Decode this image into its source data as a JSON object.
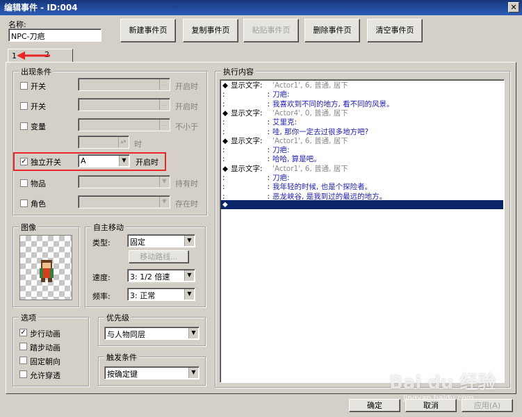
{
  "window": {
    "title": "编辑事件 - ID:004",
    "close_glyph": "✕"
  },
  "name_field": {
    "label": "名称:",
    "value": "NPC-刀疤"
  },
  "toolbar": {
    "new_page": "新建事件页",
    "copy_page": "复制事件页",
    "paste_page": "粘贴事件页",
    "delete_page": "删除事件页",
    "clear_page": "清空事件页"
  },
  "page_tabs": [
    {
      "label": "1"
    },
    {
      "label": "2"
    }
  ],
  "conditions": {
    "legend": "出现条件",
    "switch1": {
      "label": "开关",
      "suffix": "开启时",
      "checked": false
    },
    "switch2": {
      "label": "开关",
      "suffix": "开启时",
      "checked": false
    },
    "variable": {
      "label": "变量",
      "suffix": "不小于",
      "checked": false
    },
    "var_time": {
      "suffix": "时"
    },
    "self_switch": {
      "label": "独立开关",
      "value": "A",
      "suffix": "开启时",
      "checked": true
    },
    "item": {
      "label": "物品",
      "suffix": "持有时",
      "checked": false
    },
    "actor": {
      "label": "角色",
      "suffix": "存在时",
      "checked": false
    }
  },
  "image": {
    "legend": "图像"
  },
  "autonomous": {
    "legend": "自主移动",
    "type_label": "类型:",
    "type_value": "固定",
    "route_button": "移动路线...",
    "speed_label": "速度:",
    "speed_value": "3: 1/2 倍速",
    "freq_label": "频率:",
    "freq_value": "3: 正常"
  },
  "options": {
    "legend": "选项",
    "items": [
      {
        "label": "步行动画",
        "checked": true
      },
      {
        "label": "踏步动画",
        "checked": false
      },
      {
        "label": "固定朝向",
        "checked": false
      },
      {
        "label": "允许穿透",
        "checked": false
      }
    ]
  },
  "priority": {
    "legend": "优先级",
    "value": "与人物同层"
  },
  "trigger": {
    "legend": "触发条件",
    "value": "按确定键"
  },
  "commands": {
    "legend": "执行内容",
    "lines": [
      {
        "prefix": "◆",
        "head": "显示文字:",
        "text": "'Actor1', 6, 普通, 居下",
        "style": "gray"
      },
      {
        "prefix": ":",
        "head": ":",
        "text": "刀疤:",
        "style": "blue"
      },
      {
        "prefix": ":",
        "head": ":",
        "text": "我喜欢到不同的地方, 看不同的风景。",
        "style": "blue"
      },
      {
        "prefix": "◆",
        "head": "显示文字:",
        "text": "'Actor4', 0, 普通, 居下",
        "style": "gray"
      },
      {
        "prefix": ":",
        "head": ":",
        "text": "艾里克:",
        "style": "blue"
      },
      {
        "prefix": ":",
        "head": ":",
        "text": "哇, 那你一定去过很多地方吧?",
        "style": "blue"
      },
      {
        "prefix": "◆",
        "head": "显示文字:",
        "text": "'Actor1', 6, 普通, 居下",
        "style": "gray"
      },
      {
        "prefix": ":",
        "head": ":",
        "text": "刀疤:",
        "style": "blue"
      },
      {
        "prefix": ":",
        "head": ":",
        "text": "哈哈, 算是吧。",
        "style": "blue"
      },
      {
        "prefix": "◆",
        "head": "显示文字:",
        "text": "'Actor1', 6, 普通, 居下",
        "style": "gray"
      },
      {
        "prefix": ":",
        "head": ":",
        "text": "刀疤:",
        "style": "blue"
      },
      {
        "prefix": ":",
        "head": ":",
        "text": "我年轻的时候, 也是个探险者。",
        "style": "blue"
      },
      {
        "prefix": ":",
        "head": ":",
        "text": "恶龙峡谷, 是我到过的最远的地方。",
        "style": "blue"
      }
    ],
    "selected_line": "◆"
  },
  "footer": {
    "ok": "确定",
    "cancel": "取消",
    "apply": "应用(A)"
  },
  "watermark": "Bai du 经验",
  "watermark_url": "jingyan.baidu.com",
  "colors": {
    "accent_red": "#e8262b",
    "selection": "#0a246a",
    "cmd_blue": "#1c1cb4",
    "cmd_gray": "#8a8a8a"
  }
}
